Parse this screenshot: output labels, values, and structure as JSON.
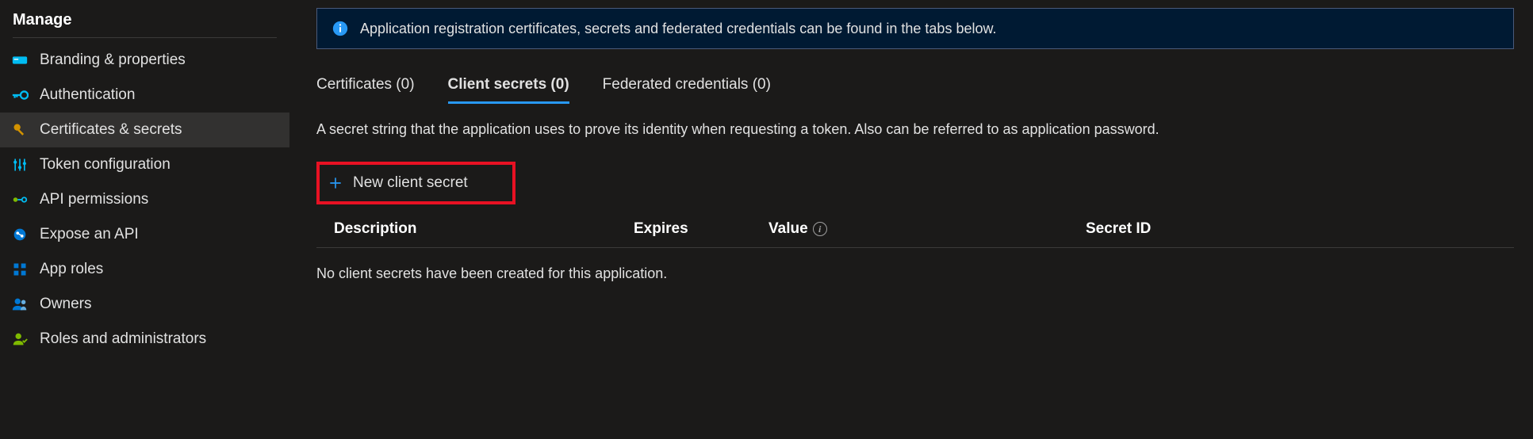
{
  "sidebar": {
    "section_label": "Manage",
    "items": [
      {
        "label": "Branding & properties"
      },
      {
        "label": "Authentication"
      },
      {
        "label": "Certificates & secrets"
      },
      {
        "label": "Token configuration"
      },
      {
        "label": "API permissions"
      },
      {
        "label": "Expose an API"
      },
      {
        "label": "App roles"
      },
      {
        "label": "Owners"
      },
      {
        "label": "Roles and administrators"
      }
    ]
  },
  "banner": {
    "text": "Application registration certificates, secrets and federated credentials can be found in the tabs below."
  },
  "tabs": {
    "certificates": "Certificates (0)",
    "client_secrets": "Client secrets (0)",
    "federated": "Federated credentials (0)"
  },
  "tab_description": "A secret string that the application uses to prove its identity when requesting a token. Also can be referred to as application password.",
  "new_secret_label": "New client secret",
  "table": {
    "col_description": "Description",
    "col_expires": "Expires",
    "col_value": "Value",
    "col_secret_id": "Secret ID",
    "empty_message": "No client secrets have been created for this application."
  }
}
